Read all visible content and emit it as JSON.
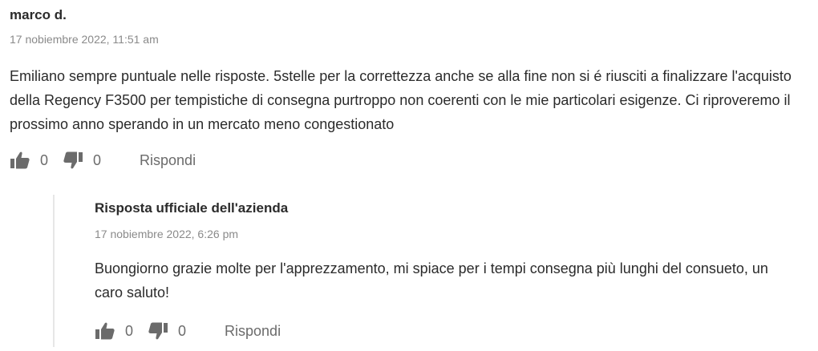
{
  "review": {
    "author": "marco d.",
    "date": "17 nobiembre 2022, 11:51 am",
    "body": "Emiliano sempre puntuale nelle risposte. 5stelle per la correttezza anche se alla fine non si é riusciti a finalizzare l'acquisto della Regency F3500 per tempistiche di consegna purtroppo non coerenti con le mie particolari esigenze. Ci riproveremo il prossimo anno sperando in un mercato meno congestionato",
    "likes": "0",
    "dislikes": "0",
    "reply_label": "Rispondi"
  },
  "official_reply": {
    "author": "Risposta ufficiale dell'azienda",
    "date": "17 nobiembre 2022, 6:26 pm",
    "body": "Buongiorno grazie molte per l'apprezzamento, mi spiace per i tempi consegna più lunghi del consueto, un caro saluto!",
    "likes": "0",
    "dislikes": "0",
    "reply_label": "Rispondi"
  },
  "icons": {
    "like": "thumbs-up-icon",
    "dislike": "thumbs-down-icon"
  },
  "colors": {
    "text": "#2b2b2b",
    "muted": "#8a8a8a",
    "icon": "#6b6b6b",
    "divider": "#e6e6e6"
  }
}
